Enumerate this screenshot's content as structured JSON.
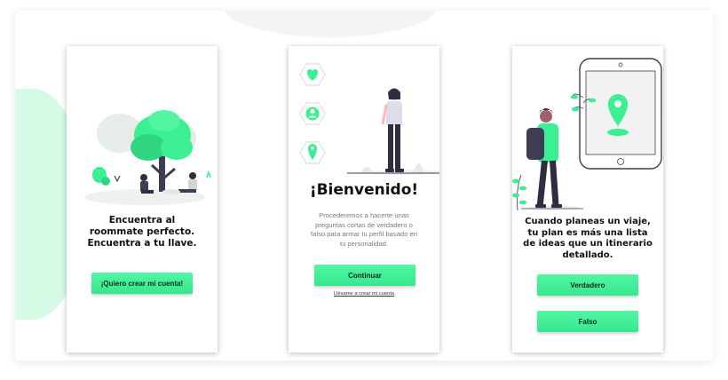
{
  "screens": [
    {
      "heading": "Encuentra al roommate perfecto. Encuentra a tu llave.",
      "button": "¡Quiero crear mi cuenta!"
    },
    {
      "icons": [
        "heart-icon",
        "user-icon",
        "location-pin-icon"
      ],
      "heading": "¡Bienvenido!",
      "body": "Procederemos a hacerte unas preguntas cortas de verdadero o falso para armar tu perfil basado en tu personalidad.",
      "button": "Continuar",
      "link": "Llévame a crear mi cuenta"
    },
    {
      "heading": "Cuando planeas un viaje, tu plan es más una lista de ideas que un itinerario detallado.",
      "buttons": [
        "Verdadero",
        "Falso"
      ]
    }
  ],
  "colors": {
    "accent": "#3bef93",
    "accent_dark": "#2fd67f",
    "person_dark": "#2f2e41",
    "background_blob": "#d5fbe6"
  }
}
